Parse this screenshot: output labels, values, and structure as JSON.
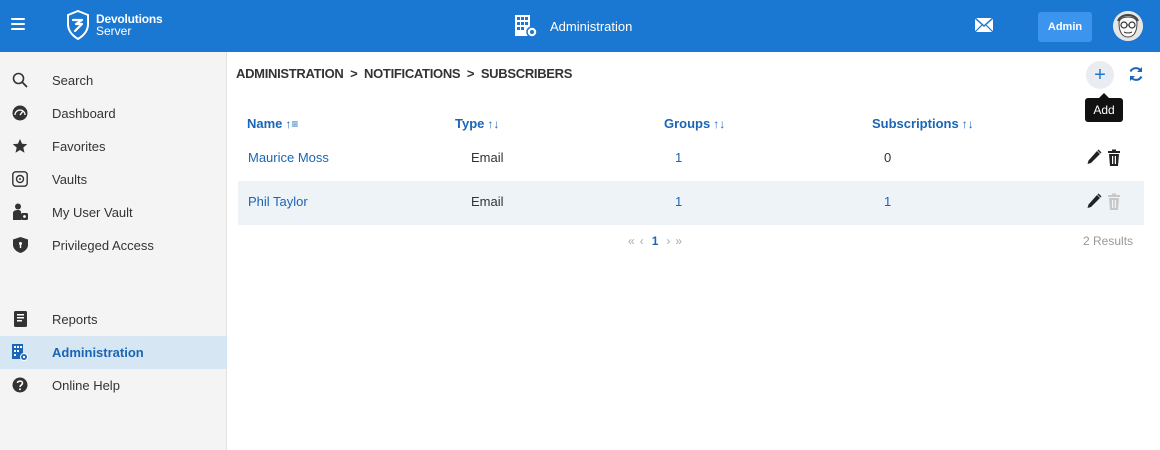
{
  "header": {
    "brand_title": "Devolutions",
    "brand_sub": "Server",
    "center_label": "Administration",
    "admin_label": "Admin"
  },
  "sidebar": {
    "items": [
      {
        "label": "Search",
        "icon": "search-icon"
      },
      {
        "label": "Dashboard",
        "icon": "dashboard-icon"
      },
      {
        "label": "Favorites",
        "icon": "star-icon"
      },
      {
        "label": "Vaults",
        "icon": "vault-icon"
      },
      {
        "label": "My User Vault",
        "icon": "user-vault-icon"
      },
      {
        "label": "Privileged Access",
        "icon": "shield-icon"
      },
      {
        "label": "Reports",
        "icon": "reports-icon"
      },
      {
        "label": "Administration",
        "icon": "administration-icon",
        "active": true
      },
      {
        "label": "Online Help",
        "icon": "help-icon"
      }
    ]
  },
  "breadcrumb": "ADMINISTRATION  >  NOTIFICATIONS  >  SUBSCRIBERS",
  "tooltip": "Add",
  "table": {
    "columns": [
      {
        "label": "Name",
        "sort": "↑≡"
      },
      {
        "label": "Type",
        "sort": "↑↓"
      },
      {
        "label": "Groups",
        "sort": "↑↓"
      },
      {
        "label": "Subscriptions",
        "sort": "↑↓"
      }
    ],
    "rows": [
      {
        "name": "Maurice Moss",
        "type": "Email",
        "groups": "1",
        "subscriptions": "0"
      },
      {
        "name": "Phil Taylor",
        "type": "Email",
        "groups": "1",
        "subscriptions": "1"
      }
    ]
  },
  "pager": {
    "first": "«",
    "prev": "‹",
    "current": "1",
    "next": "›",
    "last": "»"
  },
  "results": "2 Results",
  "colors": {
    "topbar": "#1a77d2",
    "link": "#1a65b5",
    "active_bg": "#d7e6f3",
    "row_alt": "#eef3f8"
  }
}
